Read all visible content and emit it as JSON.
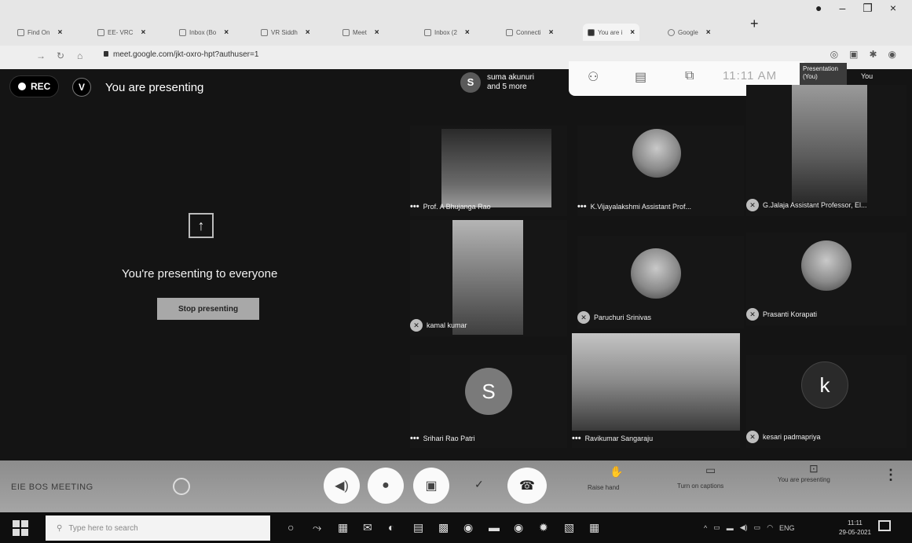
{
  "browser": {
    "tabs": [
      {
        "label": "Find On",
        "active": false
      },
      {
        "label": "EE- VRC",
        "active": false
      },
      {
        "label": "Inbox (Bo",
        "active": false
      },
      {
        "label": "VR Siddh",
        "active": false
      },
      {
        "label": "Meet",
        "active": false
      },
      {
        "label": "Inbox (2",
        "active": false
      },
      {
        "label": "Connecti",
        "active": false
      },
      {
        "label": "You are i",
        "active": true
      },
      {
        "label": "Google",
        "active": false
      }
    ],
    "url": "meet.google.com/jkt-oxro-hpt?authuser=1"
  },
  "meet": {
    "rec_label": "REC",
    "presenter_initial": "V",
    "header_title": "You are presenting",
    "participants_chip": {
      "initial": "S",
      "line1": "suma akunuri",
      "line2": "and 5 more"
    },
    "clock": "11:11 AM",
    "presentation_chip": "Presentation (You)",
    "you_label": "You",
    "presenting_message": "You're presenting to everyone",
    "stop_label": "Stop presenting",
    "tiles": [
      {
        "name": "Prof. A Bhujanga Rao",
        "kind": "video",
        "prefix": "dots"
      },
      {
        "name": "K.Vijayalakshmi Assistant Prof...",
        "kind": "photo",
        "prefix": "dots"
      },
      {
        "name": "G.Jalaja Assistant Professor, El...",
        "kind": "video",
        "prefix": "mute"
      },
      {
        "name": "kamal kumar",
        "kind": "video",
        "prefix": "mute"
      },
      {
        "name": "Paruchuri Srinivas",
        "kind": "photo",
        "prefix": "mute"
      },
      {
        "name": "Prasanti Korapati",
        "kind": "photo",
        "prefix": "mute"
      },
      {
        "name": "Srihari Rao Patri",
        "kind": "letter",
        "initial": "S",
        "color": "#7a7a7a",
        "prefix": "dots"
      },
      {
        "name": "Ravikumar Sangaraju",
        "kind": "video",
        "prefix": "dots"
      },
      {
        "name": "kesari padmapriya",
        "kind": "letter",
        "initial": "k",
        "color": "#2a2a2a",
        "prefix": "mute"
      }
    ]
  },
  "bottom": {
    "meeting_name": "EIE BOS MEETING",
    "raise_hand": "Raise hand",
    "captions": "Turn on captions",
    "you_are_presenting": "You are presenting"
  },
  "taskbar": {
    "search_placeholder": "Type here to search",
    "lang": "ENG",
    "time": "11:11",
    "date": "29-05-2021"
  }
}
